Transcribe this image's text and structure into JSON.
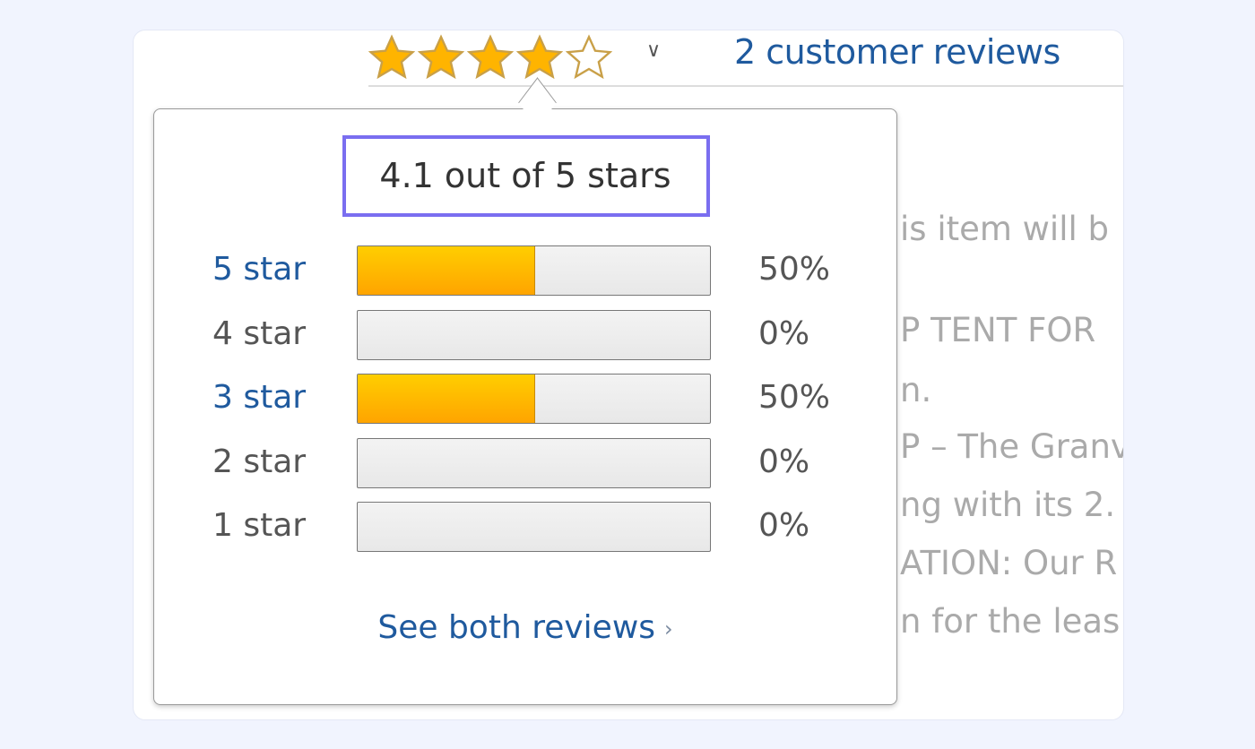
{
  "rating": {
    "value": 4.1,
    "max": 5,
    "stars_filled": 4
  },
  "header": {
    "dropdown_icon": "chevron-down-icon",
    "reviews_link": "2 customer reviews"
  },
  "background_text": [
    "is item will b",
    "P TENT FOR",
    "n.",
    "P – The Granv",
    "ng with its 2.",
    "ATION: Our R",
    "n for the leas"
  ],
  "popover": {
    "summary": "4.1 out of 5 stars",
    "rows": [
      {
        "label": "5 star",
        "percent": "50%",
        "fraction": 0.5,
        "link": true
      },
      {
        "label": "4 star",
        "percent": "0%",
        "fraction": 0,
        "link": false
      },
      {
        "label": "3 star",
        "percent": "50%",
        "fraction": 0.5,
        "link": true
      },
      {
        "label": "2 star",
        "percent": "0%",
        "fraction": 0,
        "link": false
      },
      {
        "label": "1 star",
        "percent": "0%",
        "fraction": 0,
        "link": false
      }
    ],
    "see_all": "See both reviews",
    "see_all_arrow": "›"
  },
  "colors": {
    "link": "#1f5a9e",
    "star": "#ffb400",
    "highlight": "#7a6ef0",
    "bar_fill": "#ffa400"
  }
}
